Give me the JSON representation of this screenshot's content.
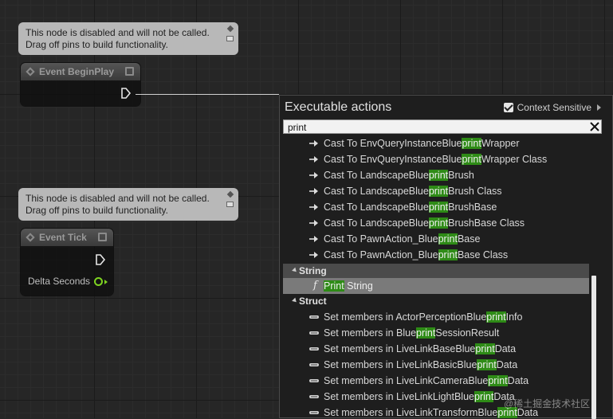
{
  "comments": {
    "top": {
      "line1": "This node is disabled and will not be called.",
      "line2": "Drag off pins to build functionality."
    },
    "mid": {
      "line1": "This node is disabled and will not be called.",
      "line2": "Drag off pins to build functionality."
    }
  },
  "nodes": {
    "begin_play": {
      "title": "Event BeginPlay"
    },
    "tick": {
      "title": "Event Tick",
      "output_label": "Delta Seconds"
    }
  },
  "menu": {
    "title": "Executable actions",
    "context_sensitive_label": "Context Sensitive",
    "context_sensitive_checked": true,
    "search_value": "print",
    "items_before": [
      {
        "pre": "Cast To EnvQueryInstanceBlue",
        "hl": "print",
        "post": "Wrapper"
      },
      {
        "pre": "Cast To EnvQueryInstanceBlue",
        "hl": "print",
        "post": "Wrapper Class"
      },
      {
        "pre": "Cast To LandscapeBlue",
        "hl": "print",
        "post": "Brush"
      },
      {
        "pre": "Cast To LandscapeBlue",
        "hl": "print",
        "post": "Brush Class"
      },
      {
        "pre": "Cast To LandscapeBlue",
        "hl": "print",
        "post": "BrushBase"
      },
      {
        "pre": "Cast To LandscapeBlue",
        "hl": "print",
        "post": "BrushBase Class"
      },
      {
        "pre": "Cast To PawnAction_Blue",
        "hl": "print",
        "post": "Base"
      },
      {
        "pre": "Cast To PawnAction_Blue",
        "hl": "print",
        "post": "Base Class"
      }
    ],
    "category_string": "String",
    "print_string": {
      "hl": "Print",
      "post": " String",
      "icon_glyph": "f"
    },
    "category_struct": "Struct",
    "items_after": [
      {
        "pre": "Set members in ActorPerceptionBlue",
        "hl": "print",
        "post": "Info"
      },
      {
        "pre": "Set members in Blue",
        "hl": "print",
        "post": "SessionResult"
      },
      {
        "pre": "Set members in LiveLinkBaseBlue",
        "hl": "print",
        "post": "Data"
      },
      {
        "pre": "Set members in LiveLinkBasicBlue",
        "hl": "print",
        "post": "Data"
      },
      {
        "pre": "Set members in LiveLinkCameraBlue",
        "hl": "print",
        "post": "Data"
      },
      {
        "pre": "Set members in LiveLinkLightBlue",
        "hl": "print",
        "post": "Data"
      },
      {
        "pre": "Set members in LiveLinkTransformBlue",
        "hl": "print",
        "post": "Data"
      }
    ]
  },
  "watermark": "@稀土掘金技术社区",
  "colors": {
    "highlight": "#2e8b16",
    "float_pin": "#7ed321",
    "comment_bg": "#b8b8b8"
  },
  "icons": {
    "cast": "cast-arrow-icon",
    "struct": "struct-bar-icon",
    "function": "function-icon"
  }
}
